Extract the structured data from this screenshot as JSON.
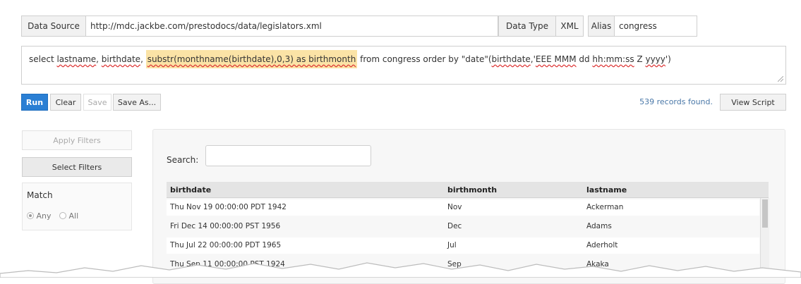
{
  "source": {
    "label": "Data Source",
    "value": "http://mdc.jackbe.com/prestodocs/data/legislators.xml"
  },
  "data_type": {
    "label": "Data Type",
    "value": "XML"
  },
  "alias": {
    "label": "Alias",
    "value": "congress"
  },
  "query": {
    "p1": "select ",
    "p2": "lastname",
    "p3": ", ",
    "p4": "birthdate",
    "p5": ", ",
    "p6": "substr(monthname(birthdate),0,3) as birthmonth",
    "p7": " from congress order by \"date\"(",
    "p8": "birthdate",
    "p9": ",'",
    "p10": "EEE MMM",
    "p11": " dd ",
    "p12": "hh:mm:ss",
    "p13": " Z ",
    "p14": "yyyy",
    "p15": "')"
  },
  "toolbar": {
    "run": "Run",
    "clear": "Clear",
    "save": "Save",
    "save_as": "Save As...",
    "records": "539 records found.",
    "view_script": "View Script"
  },
  "filters": {
    "apply": "Apply Filters",
    "select": "Select Filters",
    "match": "Match",
    "any": "Any",
    "all": "All"
  },
  "search": {
    "label": "Search:",
    "value": ""
  },
  "table": {
    "columns": [
      "birthdate",
      "birthmonth",
      "lastname"
    ],
    "rows": [
      [
        "Thu Nov 19 00:00:00 PDT 1942",
        "Nov",
        "Ackerman"
      ],
      [
        "Fri Dec 14 00:00:00 PST 1956",
        "Dec",
        "Adams"
      ],
      [
        "Thu Jul 22 00:00:00 PDT 1965",
        "Jul",
        "Aderholt"
      ],
      [
        "Thu Sep 11 00:00:00 PST 1924",
        "Sep",
        "Akaka"
      ]
    ]
  },
  "colors": {
    "accent": "#2a7fd4",
    "highlight": "#fbe3a6",
    "records_text": "#4a78a8"
  }
}
